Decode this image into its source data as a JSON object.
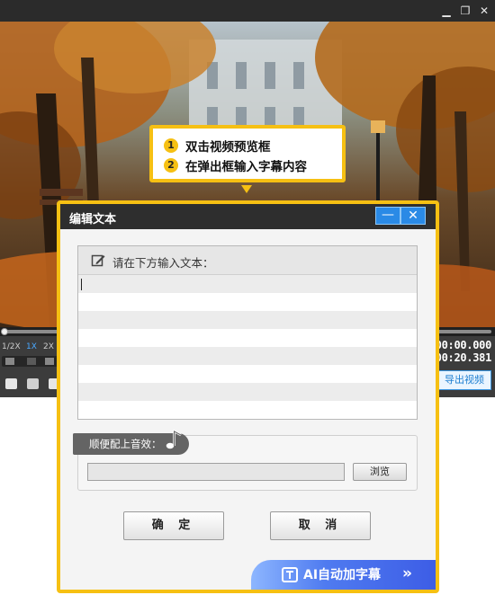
{
  "window": {
    "minimize_icon": "minimize-icon",
    "restore_icon": "restore-icon",
    "close_icon": "close-icon"
  },
  "player": {
    "speed_options": [
      "1/2X",
      "1X",
      "2X"
    ],
    "active_speed": "1X",
    "current_time": "00:00.000",
    "total_time": "00:20.381",
    "export_label": "导出视频"
  },
  "callout": {
    "steps": [
      {
        "num": "1",
        "text": "双击视频预览框"
      },
      {
        "num": "2",
        "text": "在弹出框输入字幕内容"
      }
    ],
    "accent_color": "#f6c013"
  },
  "dialog": {
    "title": "编辑文本",
    "minimize_label": "—",
    "close_label": "✕",
    "text_prompt": "请在下方输入文本：",
    "text_value": "",
    "sound_label": "顺便配上音效：",
    "sound_value": "",
    "browse_label": "浏览",
    "confirm_label": "确 定",
    "cancel_label": "取 消",
    "ai_label": "AI自动加字幕",
    "ai_arrow": "»"
  }
}
